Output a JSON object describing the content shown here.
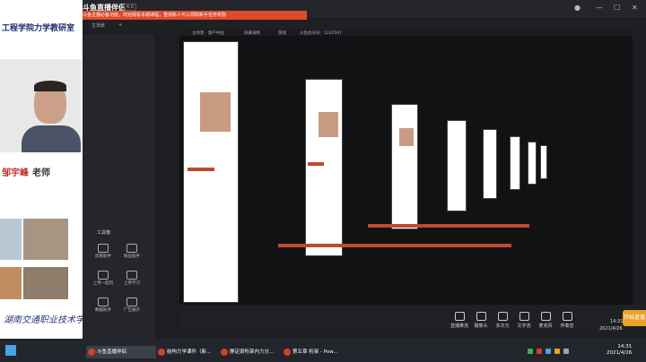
{
  "window": {
    "app_title": "斗鱼直播伴侣",
    "version_badge": "6.0",
    "notice": "斗鱼主播必备功能，欢迎观看本期课程，重视新人可以领取新手任务奖励",
    "controls": [
      "—",
      "☐",
      "✕"
    ]
  },
  "subbar": {
    "items": [
      "主场景",
      "+",
      "斗鱼游戏1753",
      "全局公告"
    ]
  },
  "scene_bar": {
    "items": [
      "主场景 · 源产中国",
      "屏幕录制",
      "游戏",
      "斗鱼房间号：1242507"
    ]
  },
  "left_panel": {
    "slide_title": "工程学院力学教研室",
    "teacher_name": "邹宇峰",
    "teacher_suffix": "老师",
    "school_calligraphy": "湖南交通职业技术学院"
  },
  "tools": {
    "header": "工具箱",
    "items": [
      {
        "label": "房管助手",
        "icon": "user-icon"
      },
      {
        "label": "粉丝助手",
        "icon": "gift-icon"
      },
      {
        "label": "上传一起玩",
        "icon": "link-icon"
      },
      {
        "label": "上传学习",
        "icon": "upload-icon"
      },
      {
        "label": "数据助手",
        "icon": "chart-icon"
      },
      {
        "label": "广告展示",
        "icon": "ad-icon"
      }
    ]
  },
  "stream_bar": {
    "items": [
      {
        "label": "直播推流",
        "icon": "monitor-icon"
      },
      {
        "label": "摄像头",
        "icon": "camera-icon"
      },
      {
        "label": "多次元",
        "icon": "layers-icon"
      },
      {
        "label": "文字流",
        "icon": "text-icon"
      },
      {
        "label": "麦克风",
        "icon": "mic-icon"
      },
      {
        "label": "伴奏音",
        "icon": "speaker-icon"
      }
    ],
    "go_live": "开始直播",
    "time": "14:31",
    "date": "2021/4/26"
  },
  "taskbar": {
    "items": [
      {
        "label": "斗鱼直播伴侣",
        "active": true
      },
      {
        "label": "结构力学课件（新...",
        "active": false
      },
      {
        "label": "静定梁桁架内力分...",
        "active": false
      },
      {
        "label": "第五章 桁架 - Pow...",
        "active": false
      }
    ],
    "clock_time": "14:31",
    "clock_date": "2021/4/26",
    "tray_colors": [
      "#3fae49",
      "#d0412a",
      "#4aa3e0",
      "#e8a32a",
      "#9aa4b2"
    ]
  }
}
